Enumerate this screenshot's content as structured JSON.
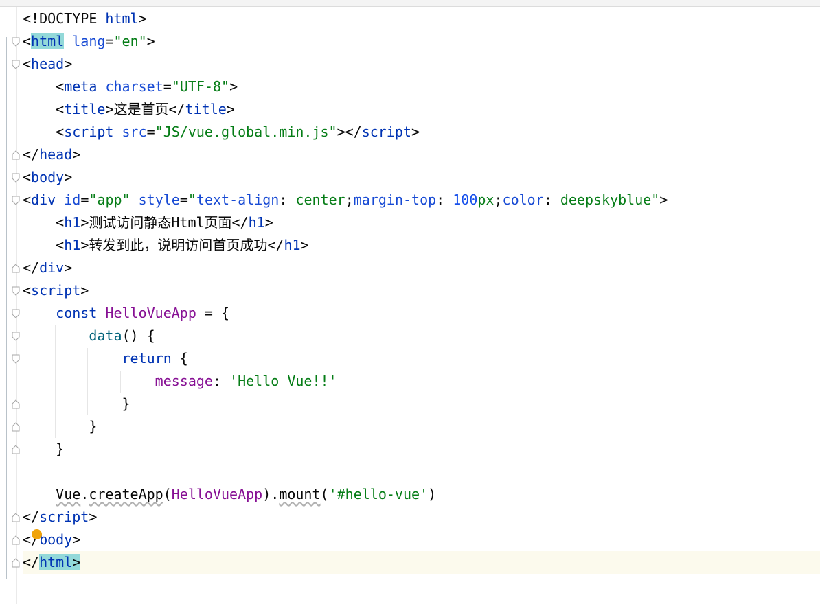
{
  "editor": {
    "lines": [
      {
        "tokens": [
          {
            "t": "<!DOCTYPE ",
            "c": "plain"
          },
          {
            "t": "html",
            "c": "tag"
          },
          {
            "t": ">",
            "c": "plain"
          }
        ]
      },
      {
        "tokens": [
          {
            "t": "<",
            "c": "plain"
          },
          {
            "t": "html",
            "c": "tag",
            "hl": true
          },
          {
            "t": " ",
            "c": "plain"
          },
          {
            "t": "lang",
            "c": "attr"
          },
          {
            "t": "=",
            "c": "plain"
          },
          {
            "t": "\"en\"",
            "c": "str"
          },
          {
            "t": ">",
            "c": "plain"
          }
        ]
      },
      {
        "tokens": [
          {
            "t": "<",
            "c": "plain"
          },
          {
            "t": "head",
            "c": "tag"
          },
          {
            "t": ">",
            "c": "plain"
          }
        ]
      },
      {
        "tokens": [
          {
            "t": "    <",
            "c": "plain"
          },
          {
            "t": "meta",
            "c": "tag"
          },
          {
            "t": " ",
            "c": "plain"
          },
          {
            "t": "charset",
            "c": "attr"
          },
          {
            "t": "=",
            "c": "plain"
          },
          {
            "t": "\"UTF-8\"",
            "c": "str"
          },
          {
            "t": ">",
            "c": "plain"
          }
        ]
      },
      {
        "tokens": [
          {
            "t": "    <",
            "c": "plain"
          },
          {
            "t": "title",
            "c": "tag"
          },
          {
            "t": ">",
            "c": "plain"
          },
          {
            "t": "这是首页",
            "c": "plain",
            "cjk": true
          },
          {
            "t": "</",
            "c": "plain"
          },
          {
            "t": "title",
            "c": "tag"
          },
          {
            "t": ">",
            "c": "plain"
          }
        ]
      },
      {
        "tokens": [
          {
            "t": "    <",
            "c": "plain"
          },
          {
            "t": "script",
            "c": "tag"
          },
          {
            "t": " ",
            "c": "plain"
          },
          {
            "t": "src",
            "c": "attr"
          },
          {
            "t": "=",
            "c": "plain"
          },
          {
            "t": "\"JS/vue.global.min.js\"",
            "c": "str"
          },
          {
            "t": "></",
            "c": "plain"
          },
          {
            "t": "script",
            "c": "tag"
          },
          {
            "t": ">",
            "c": "plain"
          }
        ]
      },
      {
        "tokens": [
          {
            "t": "</",
            "c": "plain"
          },
          {
            "t": "head",
            "c": "tag"
          },
          {
            "t": ">",
            "c": "plain"
          }
        ]
      },
      {
        "tokens": [
          {
            "t": "<",
            "c": "plain"
          },
          {
            "t": "body",
            "c": "tag"
          },
          {
            "t": ">",
            "c": "plain"
          }
        ]
      },
      {
        "tokens": [
          {
            "t": "<",
            "c": "plain"
          },
          {
            "t": "div",
            "c": "tag"
          },
          {
            "t": " ",
            "c": "plain"
          },
          {
            "t": "id",
            "c": "attr"
          },
          {
            "t": "=",
            "c": "plain"
          },
          {
            "t": "\"app\"",
            "c": "str"
          },
          {
            "t": " ",
            "c": "plain"
          },
          {
            "t": "style",
            "c": "attr"
          },
          {
            "t": "=",
            "c": "plain"
          },
          {
            "t": "\"",
            "c": "str"
          },
          {
            "t": "text-align",
            "c": "attr"
          },
          {
            "t": ": ",
            "c": "plain"
          },
          {
            "t": "center",
            "c": "val"
          },
          {
            "t": ";",
            "c": "plain"
          },
          {
            "t": "margin-top",
            "c": "attr"
          },
          {
            "t": ": ",
            "c": "plain"
          },
          {
            "t": "100",
            "c": "num"
          },
          {
            "t": "px",
            "c": "val"
          },
          {
            "t": ";",
            "c": "plain"
          },
          {
            "t": "color",
            "c": "attr"
          },
          {
            "t": ": ",
            "c": "plain"
          },
          {
            "t": "deepskyblue",
            "c": "val"
          },
          {
            "t": "\"",
            "c": "str"
          },
          {
            "t": ">",
            "c": "plain"
          }
        ]
      },
      {
        "tokens": [
          {
            "t": "    <",
            "c": "plain"
          },
          {
            "t": "h1",
            "c": "tag"
          },
          {
            "t": ">",
            "c": "plain"
          },
          {
            "t": "测试访问静态",
            "c": "plain",
            "cjk": true
          },
          {
            "t": "Html",
            "c": "plain"
          },
          {
            "t": "页面",
            "c": "plain",
            "cjk": true
          },
          {
            "t": "</",
            "c": "plain"
          },
          {
            "t": "h1",
            "c": "tag"
          },
          {
            "t": ">",
            "c": "plain"
          }
        ]
      },
      {
        "tokens": [
          {
            "t": "    <",
            "c": "plain"
          },
          {
            "t": "h1",
            "c": "tag"
          },
          {
            "t": ">",
            "c": "plain"
          },
          {
            "t": "转发到此，说明访问首页成功",
            "c": "plain",
            "cjk": true
          },
          {
            "t": "</",
            "c": "plain"
          },
          {
            "t": "h1",
            "c": "tag"
          },
          {
            "t": ">",
            "c": "plain"
          }
        ]
      },
      {
        "tokens": [
          {
            "t": "</",
            "c": "plain"
          },
          {
            "t": "div",
            "c": "tag"
          },
          {
            "t": ">",
            "c": "plain"
          }
        ]
      },
      {
        "tokens": [
          {
            "t": "<",
            "c": "plain"
          },
          {
            "t": "script",
            "c": "tag"
          },
          {
            "t": ">",
            "c": "plain"
          }
        ]
      },
      {
        "tokens": [
          {
            "t": "    ",
            "c": "plain"
          },
          {
            "t": "const",
            "c": "kw"
          },
          {
            "t": " ",
            "c": "plain"
          },
          {
            "t": "HelloVueApp",
            "c": "fn"
          },
          {
            "t": " = {",
            "c": "plain"
          }
        ]
      },
      {
        "tokens": [
          {
            "t": "        ",
            "c": "plain"
          },
          {
            "t": "data",
            "c": "method"
          },
          {
            "t": "() {",
            "c": "plain"
          }
        ]
      },
      {
        "tokens": [
          {
            "t": "            ",
            "c": "plain"
          },
          {
            "t": "return",
            "c": "kw"
          },
          {
            "t": " {",
            "c": "plain"
          }
        ]
      },
      {
        "tokens": [
          {
            "t": "                ",
            "c": "plain"
          },
          {
            "t": "message",
            "c": "prop"
          },
          {
            "t": ": ",
            "c": "plain"
          },
          {
            "t": "'Hello Vue!!'",
            "c": "str"
          }
        ]
      },
      {
        "tokens": [
          {
            "t": "            }",
            "c": "plain"
          }
        ]
      },
      {
        "tokens": [
          {
            "t": "        }",
            "c": "plain"
          }
        ]
      },
      {
        "tokens": [
          {
            "t": "    }",
            "c": "plain"
          }
        ]
      },
      {
        "tokens": []
      },
      {
        "tokens": [
          {
            "t": "    ",
            "c": "plain"
          },
          {
            "t": "Vue",
            "c": "plain",
            "sq": true
          },
          {
            "t": ".",
            "c": "plain"
          },
          {
            "t": "createApp",
            "c": "plain",
            "sq": true
          },
          {
            "t": "(",
            "c": "plain"
          },
          {
            "t": "HelloVueApp",
            "c": "fn"
          },
          {
            "t": ").",
            "c": "plain"
          },
          {
            "t": "mount",
            "c": "plain",
            "sq": true
          },
          {
            "t": "(",
            "c": "plain"
          },
          {
            "t": "'#hello-vue'",
            "c": "str"
          },
          {
            "t": ")",
            "c": "plain"
          }
        ]
      },
      {
        "tokens": [
          {
            "t": "</",
            "c": "plain"
          },
          {
            "t": "script",
            "c": "tag"
          },
          {
            "t": ">",
            "c": "plain"
          }
        ]
      },
      {
        "tokens": [
          {
            "t": "</",
            "c": "plain"
          },
          {
            "t": "body",
            "c": "tag"
          },
          {
            "t": ">",
            "c": "plain"
          }
        ]
      },
      {
        "tokens": [
          {
            "t": "</",
            "c": "plain"
          },
          {
            "t": "html",
            "c": "tag",
            "hl": true
          },
          {
            "t": ">",
            "c": "plain",
            "hl": true
          }
        ],
        "caret": true
      }
    ]
  },
  "gutter": {
    "fold_markers": [
      {
        "line": 1,
        "kind": "open"
      },
      {
        "line": 2,
        "kind": "open"
      },
      {
        "line": 6,
        "kind": "close"
      },
      {
        "line": 7,
        "kind": "open"
      },
      {
        "line": 8,
        "kind": "open"
      },
      {
        "line": 11,
        "kind": "close"
      },
      {
        "line": 12,
        "kind": "open"
      },
      {
        "line": 13,
        "kind": "open"
      },
      {
        "line": 14,
        "kind": "open"
      },
      {
        "line": 15,
        "kind": "open"
      },
      {
        "line": 17,
        "kind": "close"
      },
      {
        "line": 18,
        "kind": "close"
      },
      {
        "line": 19,
        "kind": "close"
      },
      {
        "line": 22,
        "kind": "close"
      },
      {
        "line": 23,
        "kind": "close"
      },
      {
        "line": 24,
        "kind": "close"
      }
    ],
    "intention_icon": "lightbulb-icon"
  },
  "colors": {
    "tag": "#0033b3",
    "attr": "#174ad4",
    "string": "#067d17",
    "keyword": "#0033b3",
    "identifier": "#871094",
    "caret_line": "#fcfaed",
    "match_highlight": "#93d9d9"
  }
}
